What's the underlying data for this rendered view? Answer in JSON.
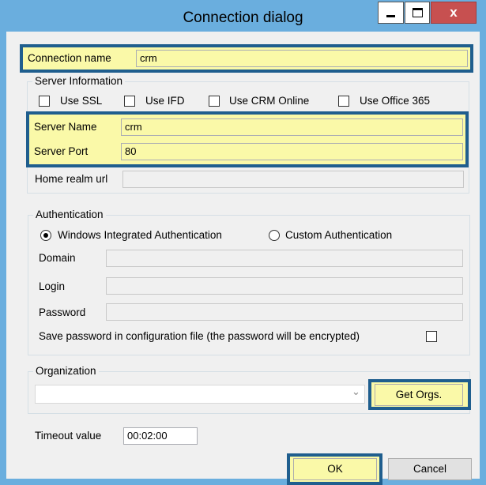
{
  "window": {
    "title": "Connection dialog",
    "minimize_glyph": "minimize-icon",
    "maximize_glyph": "maximize-icon",
    "close_label": "x"
  },
  "connection": {
    "name_label": "Connection name",
    "name_value": "crm"
  },
  "server_info": {
    "legend": "Server Information",
    "checkboxes": [
      {
        "label": "Use SSL",
        "checked": false
      },
      {
        "label": "Use IFD",
        "checked": false
      },
      {
        "label": "Use CRM Online",
        "checked": false
      },
      {
        "label": "Use Office 365",
        "checked": false
      }
    ],
    "server_name_label": "Server Name",
    "server_name_value": "crm",
    "server_port_label": "Server Port",
    "server_port_value": "80",
    "home_realm_label": "Home realm url",
    "home_realm_value": ""
  },
  "authentication": {
    "legend": "Authentication",
    "radio_windows": "Windows Integrated Authentication",
    "radio_custom": "Custom Authentication",
    "selected": "Windows Integrated Authentication",
    "domain_label": "Domain",
    "login_label": "Login",
    "password_label": "Password",
    "save_password_label": "Save password in configuration file (the password will be encrypted)"
  },
  "organization": {
    "legend": "Organization",
    "selected": "",
    "get_orgs_label": "Get Orgs."
  },
  "timeout": {
    "label": "Timeout value",
    "value": "00:02:00"
  },
  "buttons": {
    "ok": "OK",
    "cancel": "Cancel"
  },
  "colors": {
    "titlebar": "#6aaede",
    "highlight": "#faf9a8",
    "highlight_border": "#1f5e8e",
    "close": "#c75050"
  }
}
